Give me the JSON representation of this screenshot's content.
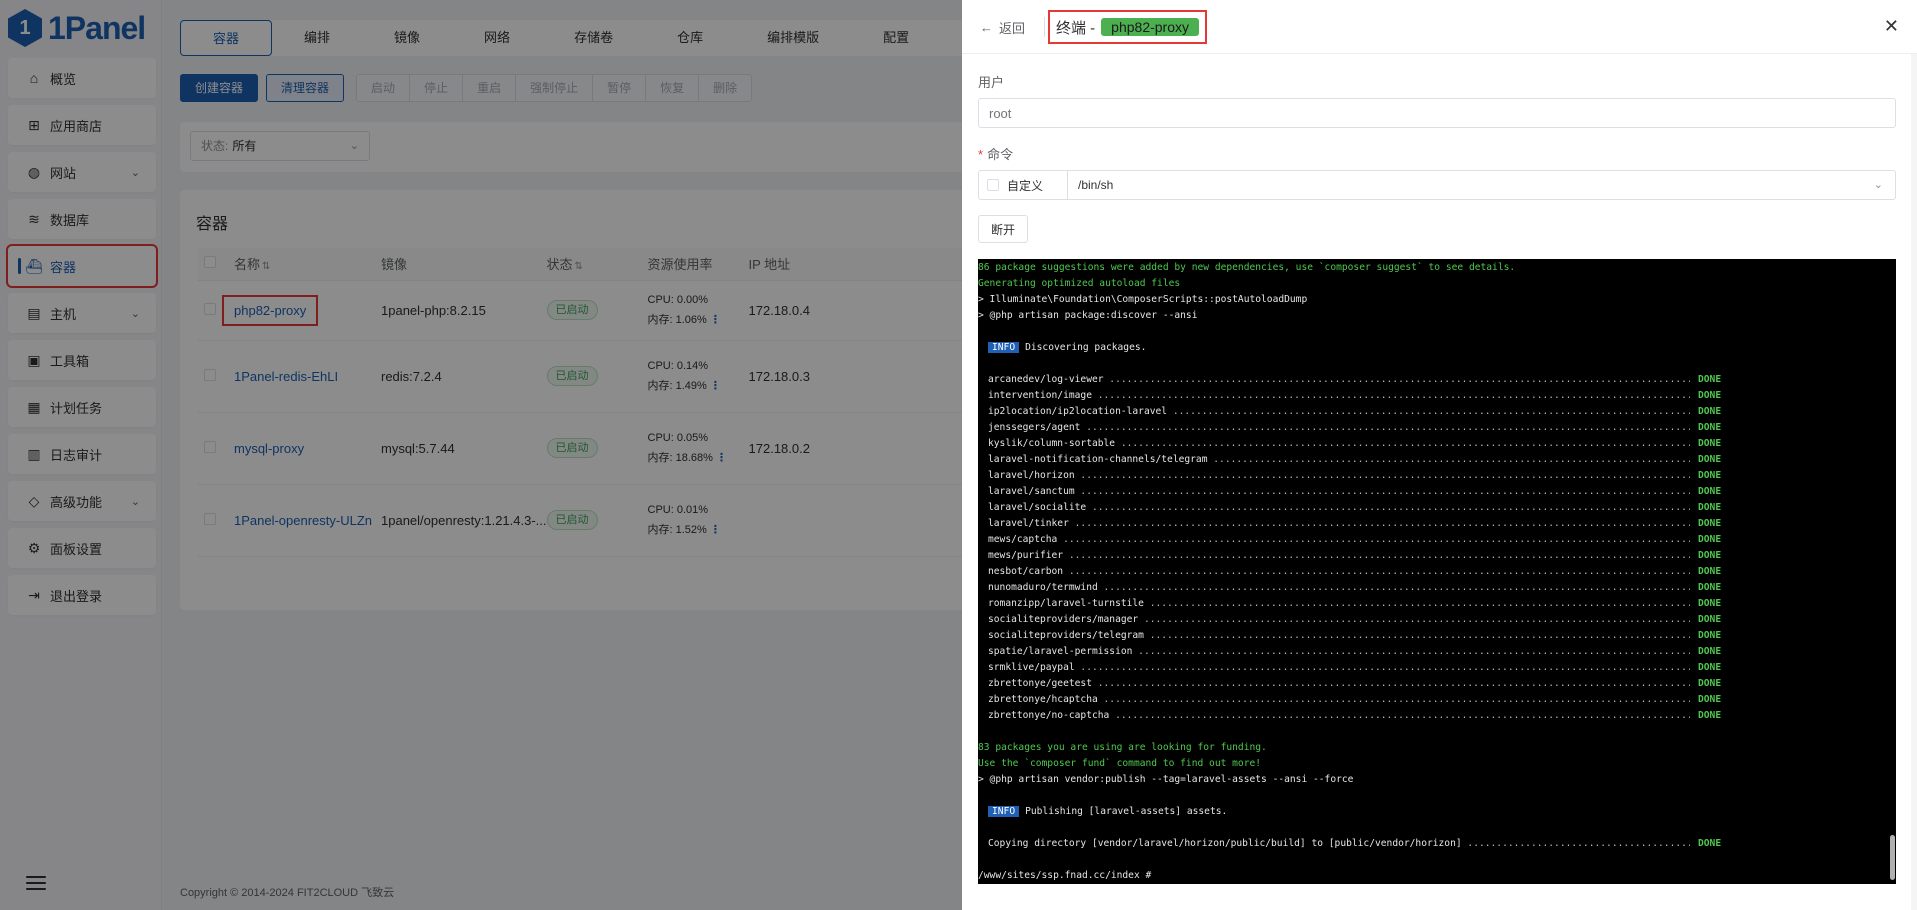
{
  "brand": {
    "logo_text": "1Panel",
    "primary_color": "#1d5fb3"
  },
  "sidebar": {
    "items": [
      {
        "label": "概览",
        "icon": "home-icon",
        "chevron": false,
        "active": false
      },
      {
        "label": "应用商店",
        "icon": "grid-icon",
        "chevron": false,
        "active": false
      },
      {
        "label": "网站",
        "icon": "globe-icon",
        "chevron": true,
        "active": false
      },
      {
        "label": "数据库",
        "icon": "layers-icon",
        "chevron": false,
        "active": false
      },
      {
        "label": "容器",
        "icon": "docker-icon",
        "chevron": false,
        "active": true
      },
      {
        "label": "主机",
        "icon": "server-icon",
        "chevron": true,
        "active": false
      },
      {
        "label": "工具箱",
        "icon": "toolbox-icon",
        "chevron": false,
        "active": false
      },
      {
        "label": "计划任务",
        "icon": "calendar-icon",
        "chevron": false,
        "active": false
      },
      {
        "label": "日志审计",
        "icon": "log-icon",
        "chevron": false,
        "active": false
      },
      {
        "label": "高级功能",
        "icon": "diamond-icon",
        "chevron": true,
        "active": false
      },
      {
        "label": "面板设置",
        "icon": "gear-icon",
        "chevron": false,
        "active": false
      },
      {
        "label": "退出登录",
        "icon": "logout-icon",
        "chevron": false,
        "active": false
      }
    ]
  },
  "tabs": [
    "容器",
    "编排",
    "镜像",
    "网络",
    "存储卷",
    "仓库",
    "编排模版",
    "配置"
  ],
  "toolbar": {
    "create": "创建容器",
    "clean": "清理容器",
    "group": [
      "启动",
      "停止",
      "重启",
      "强制停止",
      "暂停",
      "恢复",
      "删除"
    ]
  },
  "filter": {
    "label": "状态:",
    "value": "所有"
  },
  "card": {
    "title": "容器",
    "columns": {
      "name": "名称",
      "image": "镜像",
      "status": "状态",
      "resource": "资源使用率",
      "ip": "IP 地址"
    },
    "rows": [
      {
        "name": "php82-proxy",
        "image": "1panel-php:8.2.15",
        "status": "已启动",
        "cpu": "CPU: 0.00%",
        "mem": "内存: 1.06%",
        "ip": "172.18.0.4"
      },
      {
        "name": "1Panel-redis-EhLI",
        "image": "redis:7.2.4",
        "status": "已启动",
        "cpu": "CPU: 0.14%",
        "mem": "内存: 1.49%",
        "ip": "172.18.0.3"
      },
      {
        "name": "mysql-proxy",
        "image": "mysql:5.7.44",
        "status": "已启动",
        "cpu": "CPU: 0.05%",
        "mem": "内存: 18.68%",
        "ip": "172.18.0.2"
      },
      {
        "name": "1Panel-openresty-ULZn",
        "image": "1panel/openresty:1.21.4.3-...",
        "status": "已启动",
        "cpu": "CPU: 0.01%",
        "mem": "内存: 1.52%",
        "ip": ""
      }
    ]
  },
  "footer": "Copyright © 2014-2024 FIT2CLOUD 飞致云",
  "drawer": {
    "back": "返回",
    "title_prefix": "终端 -",
    "title_name": "php82-proxy",
    "user_label": "用户",
    "user_placeholder": "root",
    "command_label": "命令",
    "custom_label": "自定义",
    "command_value": "/bin/sh",
    "disconnect": "断开"
  },
  "terminal": {
    "lines": [
      {
        "t": "green",
        "text": "86 package suggestions were added by new dependencies, use `composer suggest` to see details."
      },
      {
        "t": "green",
        "text": "Generating optimized autoload files"
      },
      {
        "t": "plain",
        "text": "> Illuminate\\Foundation\\ComposerScripts::postAutoloadDump"
      },
      {
        "t": "plain",
        "text": "> @php artisan package:discover --ansi"
      },
      {
        "t": "blank",
        "text": ""
      },
      {
        "t": "info",
        "tag": "INFO",
        "text": "Discovering packages."
      },
      {
        "t": "blank",
        "text": ""
      },
      {
        "t": "pkg",
        "text": "arcanedev/log-viewer"
      },
      {
        "t": "pkg",
        "text": "intervention/image"
      },
      {
        "t": "pkg",
        "text": "ip2location/ip2location-laravel"
      },
      {
        "t": "pkg",
        "text": "jenssegers/agent"
      },
      {
        "t": "pkg",
        "text": "kyslik/column-sortable"
      },
      {
        "t": "pkg",
        "text": "laravel-notification-channels/telegram"
      },
      {
        "t": "pkg",
        "text": "laravel/horizon"
      },
      {
        "t": "pkg",
        "text": "laravel/sanctum"
      },
      {
        "t": "pkg",
        "text": "laravel/socialite"
      },
      {
        "t": "pkg",
        "text": "laravel/tinker"
      },
      {
        "t": "pkg",
        "text": "mews/captcha"
      },
      {
        "t": "pkg",
        "text": "mews/purifier"
      },
      {
        "t": "pkg",
        "text": "nesbot/carbon"
      },
      {
        "t": "pkg",
        "text": "nunomaduro/termwind"
      },
      {
        "t": "pkg",
        "text": "romanzipp/laravel-turnstile"
      },
      {
        "t": "pkg",
        "text": "socialiteproviders/manager"
      },
      {
        "t": "pkg",
        "text": "socialiteproviders/telegram"
      },
      {
        "t": "pkg",
        "text": "spatie/laravel-permission"
      },
      {
        "t": "pkg",
        "text": "srmklive/paypal"
      },
      {
        "t": "pkg",
        "text": "zbrettonye/geetest"
      },
      {
        "t": "pkg",
        "text": "zbrettonye/hcaptcha"
      },
      {
        "t": "pkg",
        "text": "zbrettonye/no-captcha"
      },
      {
        "t": "blank",
        "text": ""
      },
      {
        "t": "green",
        "text": "83 packages you are using are looking for funding."
      },
      {
        "t": "green",
        "text": "Use the `composer fund` command to find out more!"
      },
      {
        "t": "plain",
        "text": "> @php artisan vendor:publish --tag=laravel-assets --ansi --force"
      },
      {
        "t": "blank",
        "text": ""
      },
      {
        "t": "info",
        "tag": "INFO",
        "text": "Publishing [laravel-assets] assets."
      },
      {
        "t": "blank",
        "text": ""
      },
      {
        "t": "pkg",
        "text": "Copying directory [vendor/laravel/horizon/public/build] to [public/vendor/horizon]"
      },
      {
        "t": "blank",
        "text": ""
      },
      {
        "t": "plain",
        "text": "/www/sites/ssp.fnad.cc/index # "
      }
    ],
    "done_word": "DONE"
  }
}
